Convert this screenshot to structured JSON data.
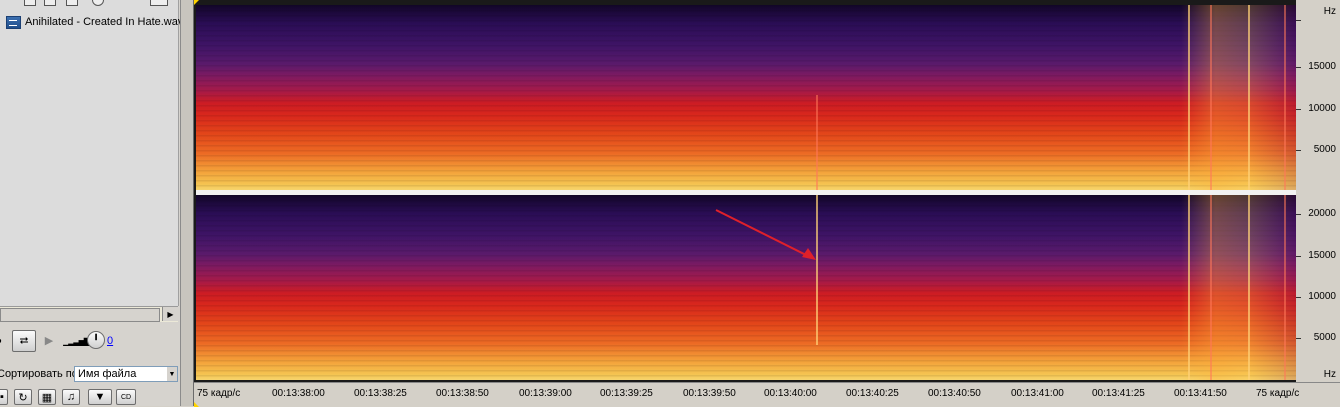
{
  "file_panel": {
    "file_name": "Anihilated - Created In Hate.wav",
    "volume_value": "0",
    "sort_label": "Сортировать по:",
    "sort_value": "Имя файла"
  },
  "frequency_axis": {
    "unit": "Hz",
    "channel1_ticks": [
      "15000",
      "10000",
      "5000"
    ],
    "channel2_ticks": [
      "20000",
      "15000",
      "10000",
      "5000"
    ]
  },
  "time_axis": {
    "rate_left": "75 кадр/с",
    "rate_right": "75 кадр/с",
    "labels": [
      "00:13:38:00",
      "00:13:38:25",
      "00:13:38:50",
      "00:13:39:00",
      "00:13:39:25",
      "00:13:39:50",
      "00:13:40:00",
      "00:13:40:25",
      "00:13:40:50",
      "00:13:41:00",
      "00:13:41:25",
      "00:13:41:50"
    ]
  },
  "colors": {
    "annotation_arrow": "#e0202a",
    "spectrogram_low": "#13062a",
    "spectrogram_high": "#f6d46e"
  }
}
